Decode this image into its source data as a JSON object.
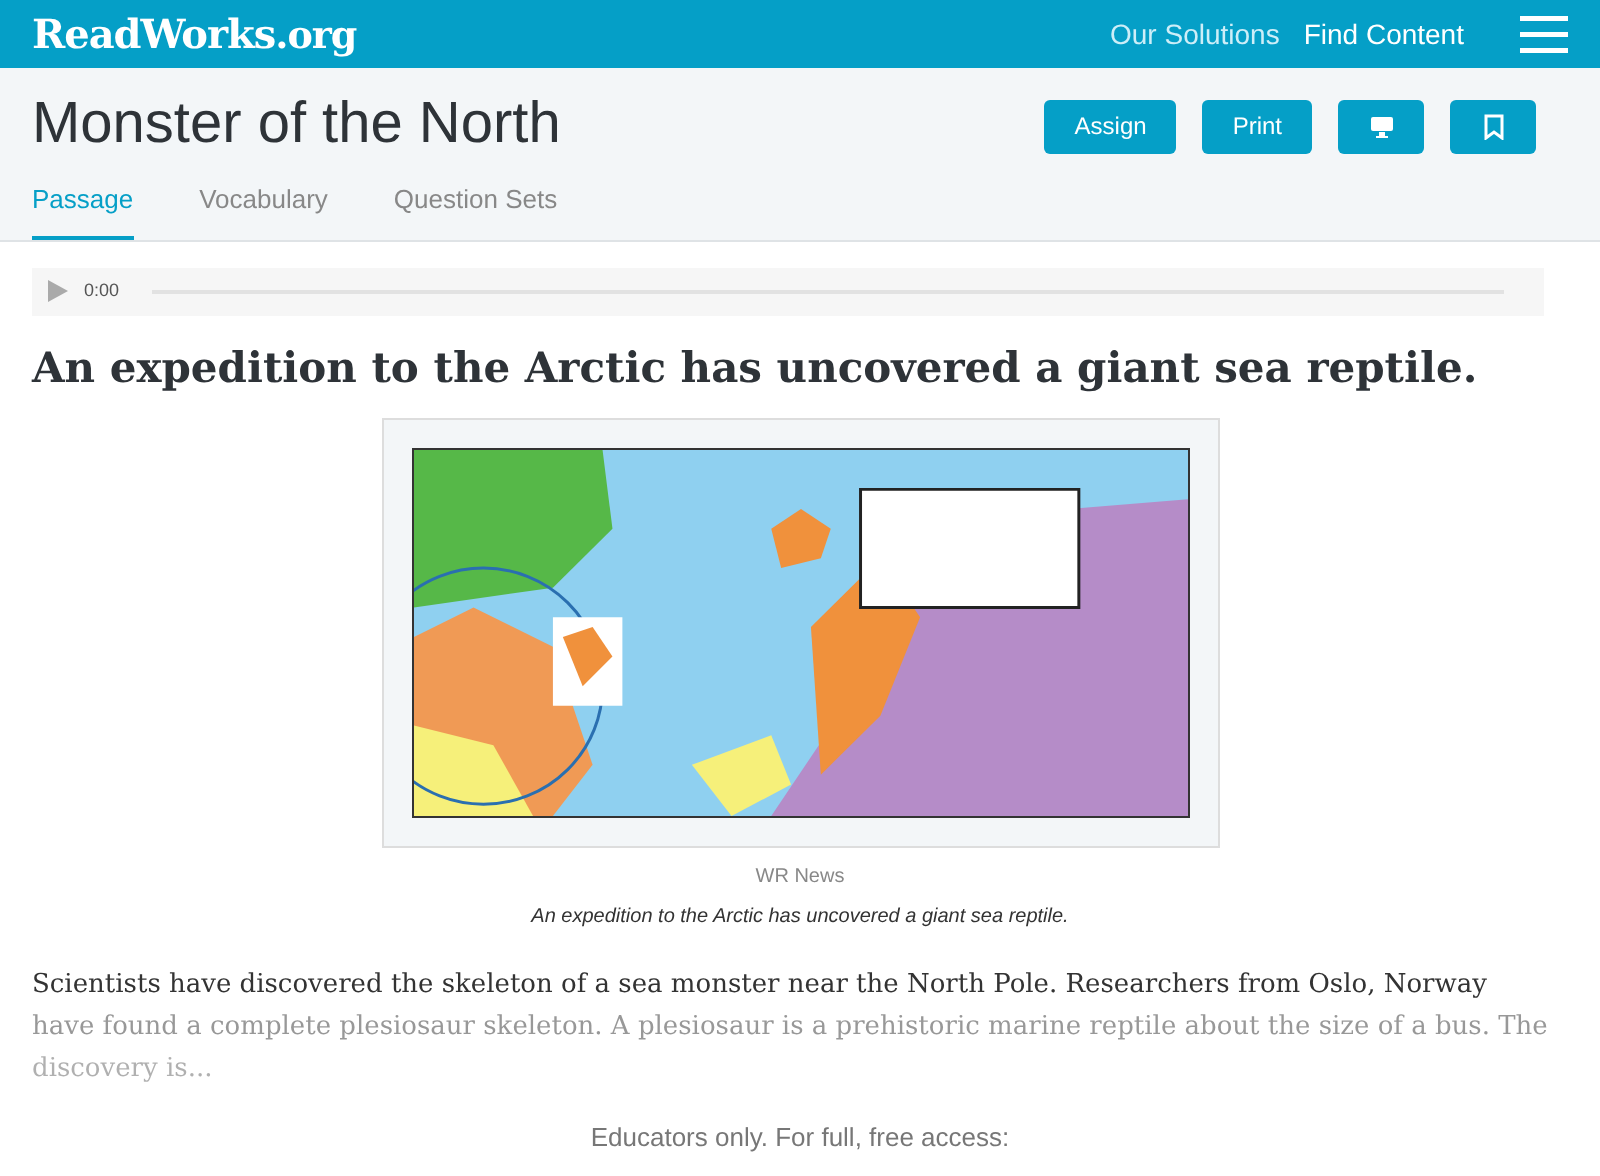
{
  "header": {
    "logo": "ReadWorks",
    "logo_suffix": ".org",
    "links": [
      {
        "label": "Our Solutions",
        "selected": false
      },
      {
        "label": "Find Content",
        "selected": true
      }
    ]
  },
  "title": "Monster of the North",
  "actions": [
    {
      "kind": "text",
      "label": "Assign"
    },
    {
      "kind": "text",
      "label": "Print"
    },
    {
      "kind": "monitor"
    },
    {
      "kind": "bookmark"
    }
  ],
  "tabs": [
    {
      "label": "Passage",
      "selected": true
    },
    {
      "label": "Vocabulary",
      "selected": false
    },
    {
      "label": "Question Sets",
      "selected": false
    }
  ],
  "audio": {
    "time": "0:00"
  },
  "heading": "An expedition to the Arctic has uncovered a giant sea reptile.",
  "figure": {
    "kind": "picture",
    "credit": "WR News",
    "caption": "An expedition to the Arctic has uncovered a giant sea reptile."
  },
  "passage_lines": [
    "Scientists have discovered the skeleton of a sea monster near the North Pole. Researchers from Oslo, Norway",
    "have found a complete plesiosaur skeleton. A plesiosaur is a prehistoric marine reptile about the size of a bus. The",
    "discovery is..."
  ],
  "access_note": "Educators only. For full, free access:"
}
